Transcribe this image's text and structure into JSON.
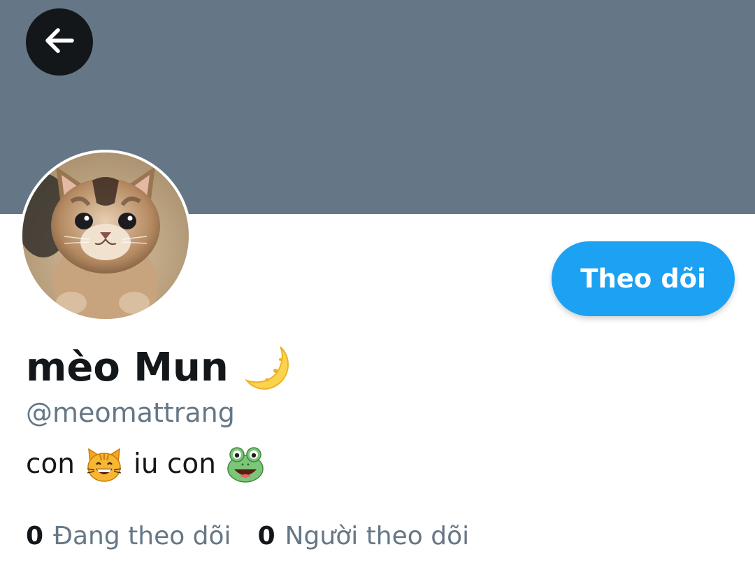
{
  "header": {
    "banner_color": "#657786",
    "back_icon": "arrow-left-icon"
  },
  "profile": {
    "avatar_icon": "kitten-avatar",
    "follow_button_label": "Theo dõi",
    "display_name": "mèo Mun",
    "display_name_emoji": "crescent-moon-icon",
    "handle": "@meomattrang",
    "bio": {
      "part1": "con",
      "emoji1": "grinning-cat-icon",
      "part2": "iu con",
      "emoji2": "frog-face-icon"
    }
  },
  "stats": {
    "following_count": "0",
    "following_label": "Đang theo dõi",
    "followers_count": "0",
    "followers_label": "Người theo dõi"
  },
  "colors": {
    "accent": "#1da1f2",
    "text_primary": "#14171a",
    "text_secondary": "#657786"
  }
}
